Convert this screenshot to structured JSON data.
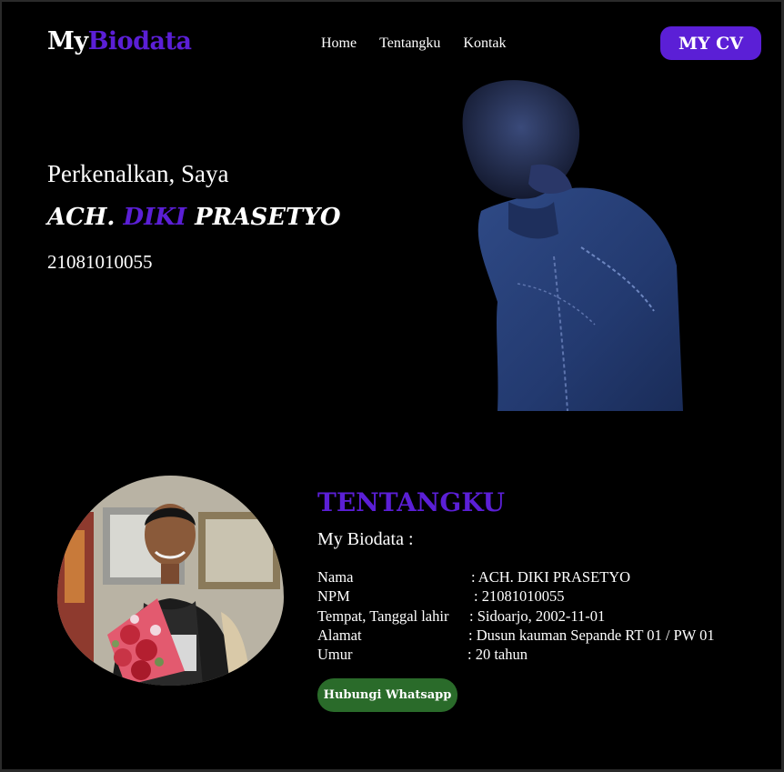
{
  "header": {
    "logo_part1": "My",
    "logo_part2": "Biodata",
    "nav": [
      "Home",
      "Tentangku",
      "Kontak"
    ],
    "cv_button": "MY CV"
  },
  "hero": {
    "greeting": "Perkenalkan, Saya",
    "name_part1": "ACH. ",
    "name_part2": "DIKI",
    "name_part3": "PRASETYO",
    "npm": "21081010055"
  },
  "about": {
    "title": "TENTANGKU",
    "subtitle": "My Biodata :",
    "rows": [
      {
        "label": "Nama",
        "value": ": ACH. DIKI PRASETYO"
      },
      {
        "label": "NPM",
        "value": ": 21081010055"
      },
      {
        "label": "Tempat, Tanggal lahir",
        "value": ": Sidoarjo, 2002-11-01"
      },
      {
        "label": "Alamat",
        "value": ": Dusun kauman Sepande RT 01 / PW 01"
      },
      {
        "label": "Umur",
        "value": ": 20 tahun"
      }
    ],
    "whatsapp_button": "Hubungi Whatsapp"
  },
  "colors": {
    "accent": "#5b1fd6",
    "background": "#000000",
    "whatsapp": "#2a6b2a"
  }
}
